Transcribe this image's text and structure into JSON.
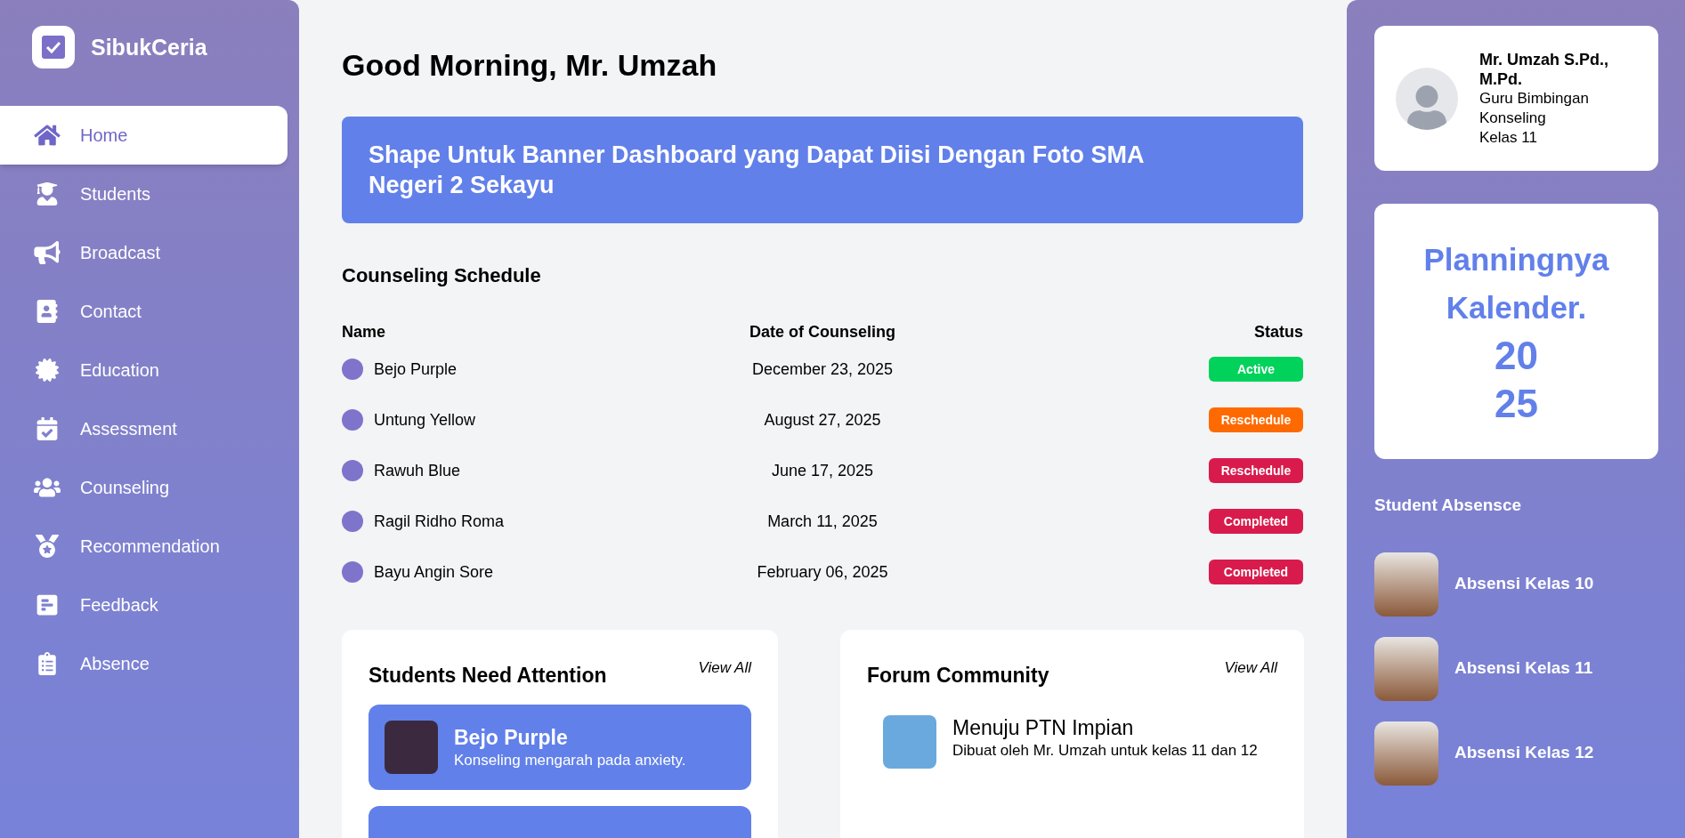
{
  "brand": {
    "name": "SibukCeria"
  },
  "sidebar": {
    "items": [
      {
        "label": "Home",
        "selected": true
      },
      {
        "label": "Students",
        "selected": false
      },
      {
        "label": "Broadcast",
        "selected": false
      },
      {
        "label": "Contact",
        "selected": false
      },
      {
        "label": "Education",
        "selected": false
      },
      {
        "label": "Assessment",
        "selected": false
      },
      {
        "label": "Counseling",
        "selected": false
      },
      {
        "label": "Recommendation",
        "selected": false
      },
      {
        "label": "Feedback",
        "selected": false
      },
      {
        "label": "Absence",
        "selected": false
      }
    ]
  },
  "greeting": "Good Morning, Mr. Umzah",
  "banner": "Shape Untuk Banner Dashboard yang Dapat Diisi Dengan Foto SMA Negeri 2 Sekayu",
  "schedule": {
    "title": "Counseling Schedule",
    "columns": [
      "Name",
      "Date of Counseling",
      "Status"
    ],
    "rows": [
      {
        "name": "Bejo Purple",
        "date": "December 23, 2025",
        "status": "Active",
        "color": "#00d25b"
      },
      {
        "name": "Untung Yellow",
        "date": "August 27, 2025",
        "status": "Reschedule",
        "color": "#ff6a00"
      },
      {
        "name": "Rawuh Blue",
        "date": "June 17, 2025",
        "status": "Reschedule",
        "color": "#d81b4c"
      },
      {
        "name": "Ragil Ridho Roma",
        "date": "March 11, 2025",
        "status": "Completed",
        "color": "#d81b4c"
      },
      {
        "name": "Bayu Angin Sore",
        "date": "February 06, 2025",
        "status": "Completed",
        "color": "#d81b4c"
      }
    ]
  },
  "attention": {
    "title": "Students Need Attention",
    "link": "View All",
    "items": [
      {
        "name": "Bejo Purple",
        "note": "Konseling mengarah pada anxiety."
      }
    ]
  },
  "forum": {
    "title": "Forum Community",
    "link": "View All",
    "items": [
      {
        "title": "Menuju PTN Impian",
        "description": "Dibuat oleh Mr. Umzah untuk kelas 11 dan 12"
      }
    ]
  },
  "profile": {
    "name": "Mr. Umzah S.Pd., M.Pd.",
    "role": "Guru Bimbingan Konseling",
    "class": "Kelas 11"
  },
  "calendar": {
    "title": "Planningnya Kalender.",
    "year_lines": [
      "20",
      "25"
    ]
  },
  "absence": {
    "title": "Student Absensce",
    "items": [
      "Absensi Kelas 10",
      "Absensi Kelas 11",
      "Absensi Kelas 12"
    ]
  }
}
